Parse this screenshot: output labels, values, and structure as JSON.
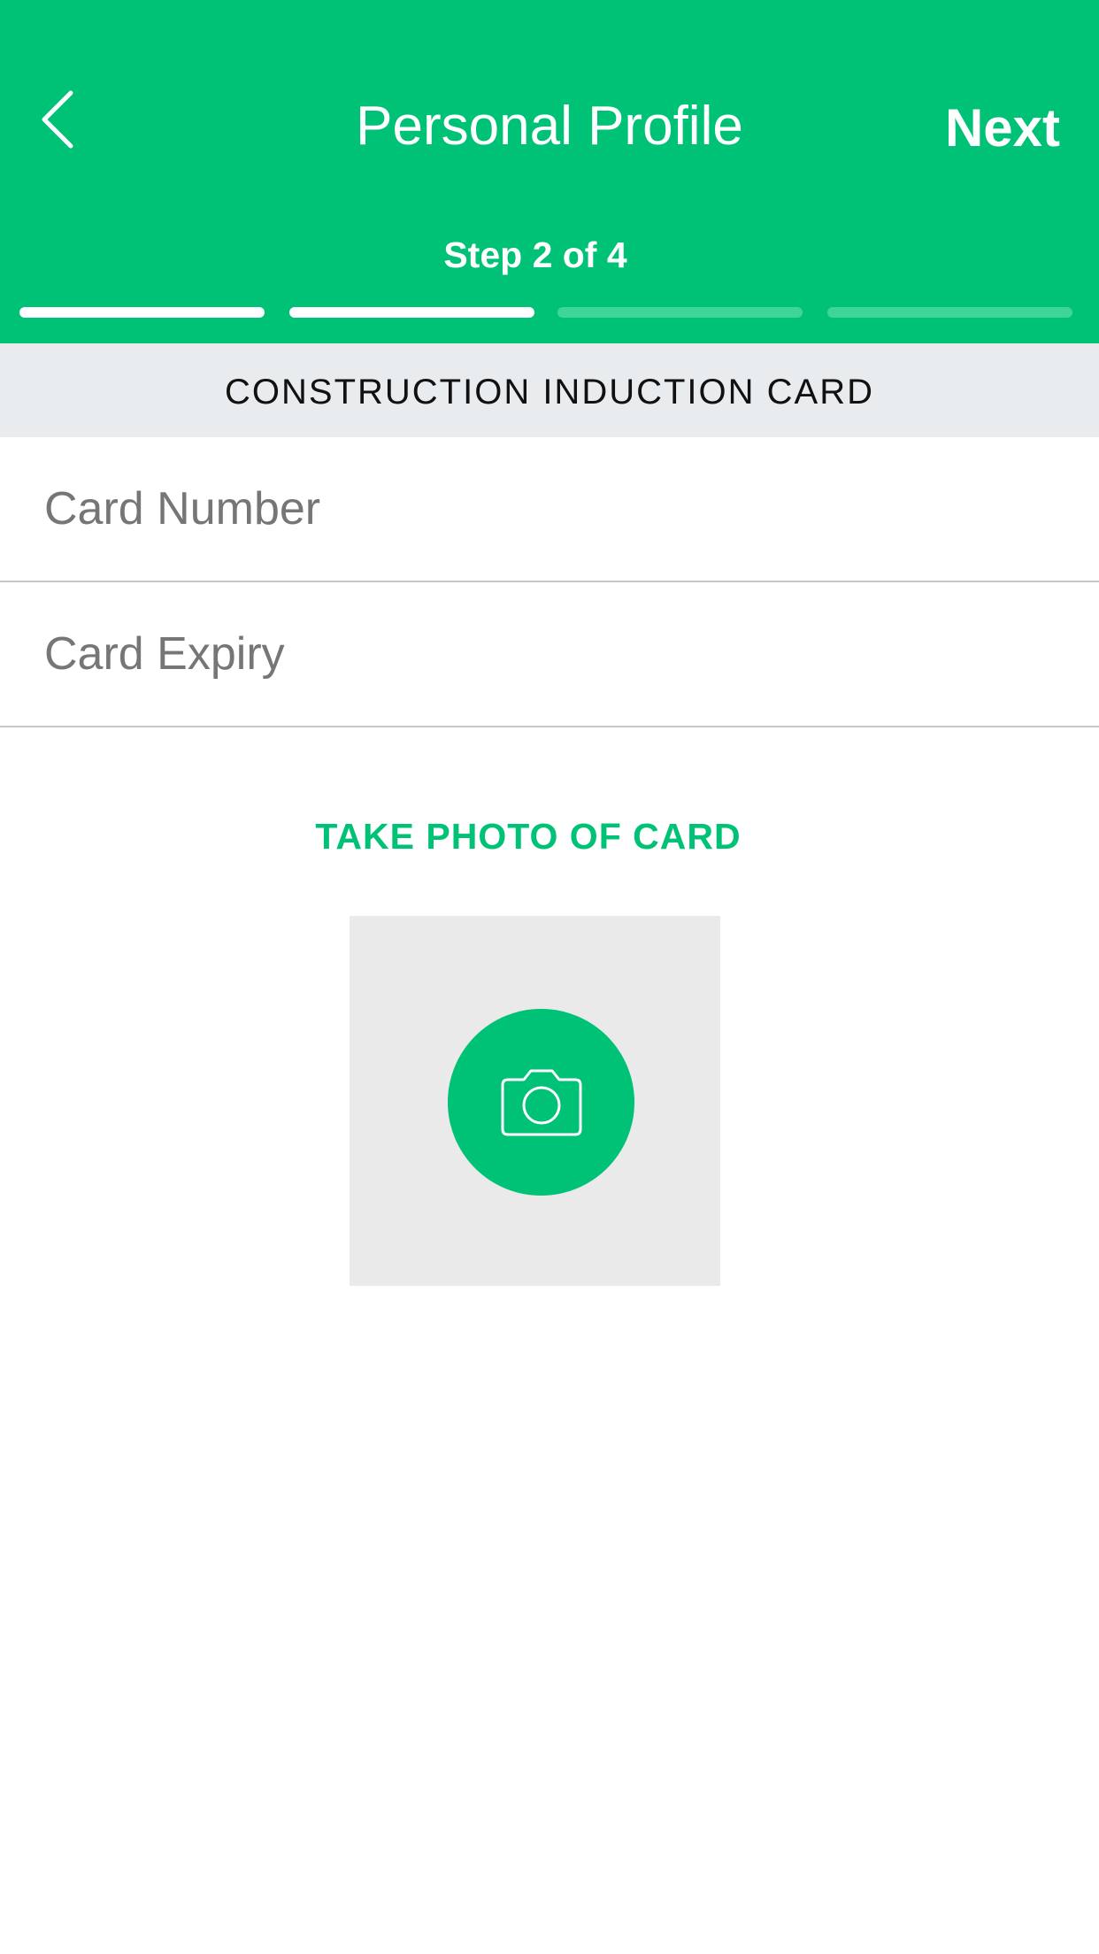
{
  "header": {
    "title": "Personal Profile",
    "next_label": "Next",
    "step_label": "Step 2 of 4",
    "progress": {
      "current_step": 2,
      "total_steps": 4
    },
    "back_icon": "chevron-left-icon",
    "color": "#00c277"
  },
  "section": {
    "title": "CONSTRUCTION INDUCTION CARD"
  },
  "form": {
    "card_number": {
      "placeholder": "Card Number",
      "value": ""
    },
    "card_expiry": {
      "placeholder": "Card Expiry",
      "value": ""
    }
  },
  "photo": {
    "link_label": "TAKE PHOTO OF CARD",
    "icon": "camera-icon"
  }
}
